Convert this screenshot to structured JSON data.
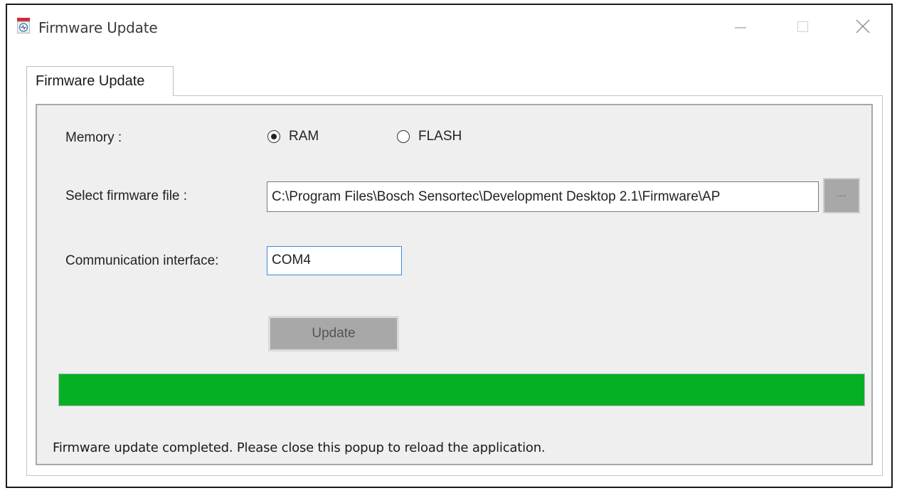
{
  "window": {
    "title": "Firmware Update",
    "icon": "bosch-app-icon"
  },
  "tabs": [
    {
      "label": "Firmware Update",
      "active": true
    }
  ],
  "form": {
    "memory_label": "Memory :",
    "memory_options": [
      {
        "label": "RAM",
        "selected": true
      },
      {
        "label": "FLASH",
        "selected": false
      }
    ],
    "file_label": "Select firmware file :",
    "file_value": "C:\\Program Files\\Bosch Sensortec\\Development Desktop 2.1\\Firmware\\AP",
    "browse_label": "....",
    "comm_label": "Communication interface:",
    "comm_value": "COM4",
    "update_label": "Update"
  },
  "progress": {
    "value": 1.0,
    "color": "#06b025"
  },
  "status_text": "Firmware update completed. Please close this popup to reload the application."
}
